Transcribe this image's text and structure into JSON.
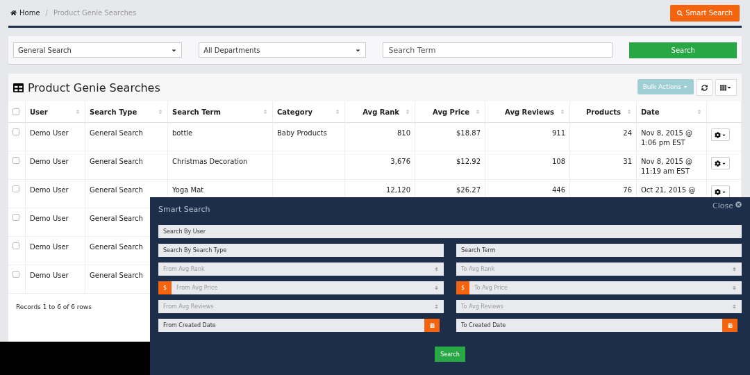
{
  "breadcrumb": {
    "home": "Home",
    "separator": "/",
    "current": "Product Genie Searches"
  },
  "smart_search_button": "Smart Search",
  "filters": {
    "search_type": "General Search",
    "department": "All Departments",
    "term_placeholder": "Search Term",
    "button": "Search"
  },
  "table": {
    "title": "Product Genie Searches",
    "bulk_actions": "Bulk Actions",
    "header_checked": false,
    "columns": [
      {
        "label": "User",
        "numeric": false
      },
      {
        "label": "Search Type",
        "numeric": false
      },
      {
        "label": "Search Term",
        "numeric": false
      },
      {
        "label": "Category",
        "numeric": false
      },
      {
        "label": "Avg Rank",
        "numeric": true
      },
      {
        "label": "Avg Price",
        "numeric": true
      },
      {
        "label": "Avg Reviews",
        "numeric": true
      },
      {
        "label": "Products",
        "numeric": true
      },
      {
        "label": "Date",
        "numeric": false
      }
    ],
    "rows": [
      {
        "checked": false,
        "cells": [
          "Demo User",
          "General Search",
          "bottle",
          "Baby Products",
          "810",
          "$18.87",
          "911",
          "24",
          "Nov 8, 2015 @ 1:06 pm EST"
        ]
      },
      {
        "checked": false,
        "cells": [
          "Demo User",
          "General Search",
          "Christmas Decoration",
          "",
          "3,676",
          "$12.92",
          "108",
          "31",
          "Nov 8, 2015 @ 11:19 am EST"
        ]
      },
      {
        "checked": false,
        "cells": [
          "Demo User",
          "General Search",
          "Yoga Mat",
          "",
          "12,120",
          "$26.27",
          "446",
          "76",
          "Oct 21, 2015 @"
        ]
      },
      {
        "checked": false,
        "cells": [
          "Demo User",
          "General Search"
        ]
      },
      {
        "checked": false,
        "cells": [
          "Demo User",
          "General Search"
        ]
      },
      {
        "checked": false,
        "cells": [
          "Demo User",
          "General Search"
        ]
      }
    ],
    "footer": "Records 1 to 6 of 6 rows"
  },
  "modal": {
    "title": "Smart Search",
    "close": "Close",
    "button": "Search",
    "rows": [
      {
        "fields": [
          {
            "kind": "text",
            "placeholder": "Search By User"
          }
        ]
      },
      {
        "fields": [
          {
            "kind": "text",
            "placeholder": "Search By Search Type"
          },
          {
            "kind": "text",
            "placeholder": "Search Term"
          }
        ]
      },
      {
        "fields": [
          {
            "kind": "number",
            "placeholder": "From Avg Rank"
          },
          {
            "kind": "number",
            "placeholder": "To Avg Rank"
          }
        ]
      },
      {
        "fields": [
          {
            "kind": "money",
            "placeholder": "From Avg Price",
            "addon": "$"
          },
          {
            "kind": "money",
            "placeholder": "To Avg Price",
            "addon": "$"
          }
        ]
      },
      {
        "fields": [
          {
            "kind": "number",
            "placeholder": "From Avg Reviews"
          },
          {
            "kind": "number",
            "placeholder": "To Avg Reviews"
          }
        ]
      },
      {
        "fields": [
          {
            "kind": "date",
            "placeholder": "From Created Date"
          },
          {
            "kind": "date",
            "placeholder": "To Created Date"
          }
        ]
      }
    ]
  }
}
